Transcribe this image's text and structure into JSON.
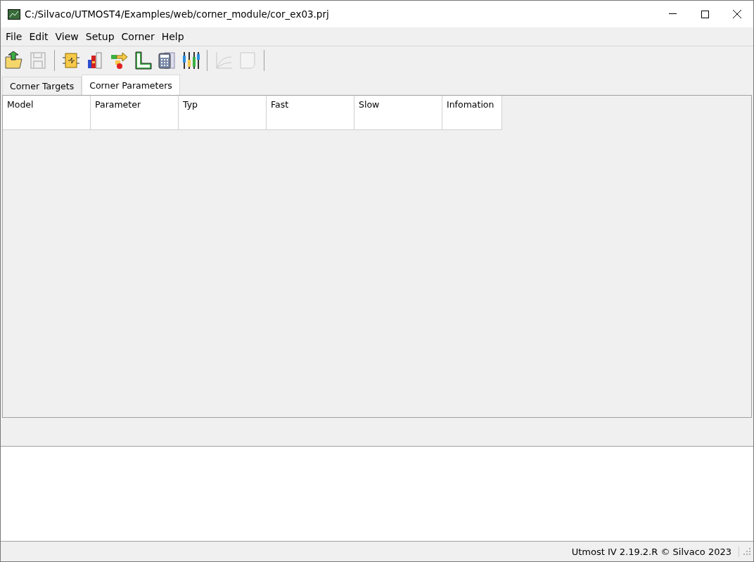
{
  "window": {
    "title": "C:/Silvaco/UTMOST4/Examples/web/corner_module/cor_ex03.prj"
  },
  "menu": [
    "File",
    "Edit",
    "View",
    "Setup",
    "Corner",
    "Help"
  ],
  "toolbar": {
    "groups": [
      [
        {
          "kind": "open",
          "disabled": false
        },
        {
          "kind": "save",
          "disabled": true
        }
      ],
      [
        {
          "kind": "circuit",
          "disabled": false
        },
        {
          "kind": "books",
          "disabled": false
        },
        {
          "kind": "flow",
          "disabled": false
        },
        {
          "kind": "ruler",
          "disabled": false
        },
        {
          "kind": "calculator",
          "disabled": false
        },
        {
          "kind": "sliders",
          "disabled": false
        }
      ],
      [
        {
          "kind": "curve",
          "disabled": true
        },
        {
          "kind": "page",
          "disabled": true
        }
      ]
    ]
  },
  "tabs": [
    {
      "label": "Corner Targets",
      "selected": false
    },
    {
      "label": "Corner Parameters",
      "selected": true
    }
  ],
  "table": {
    "columns": [
      "Model",
      "Parameter",
      "Typ",
      "Fast",
      "Slow",
      "Infomation"
    ]
  },
  "status_bar": "Utmost IV 2.19.2.R © Silvaco 2023"
}
